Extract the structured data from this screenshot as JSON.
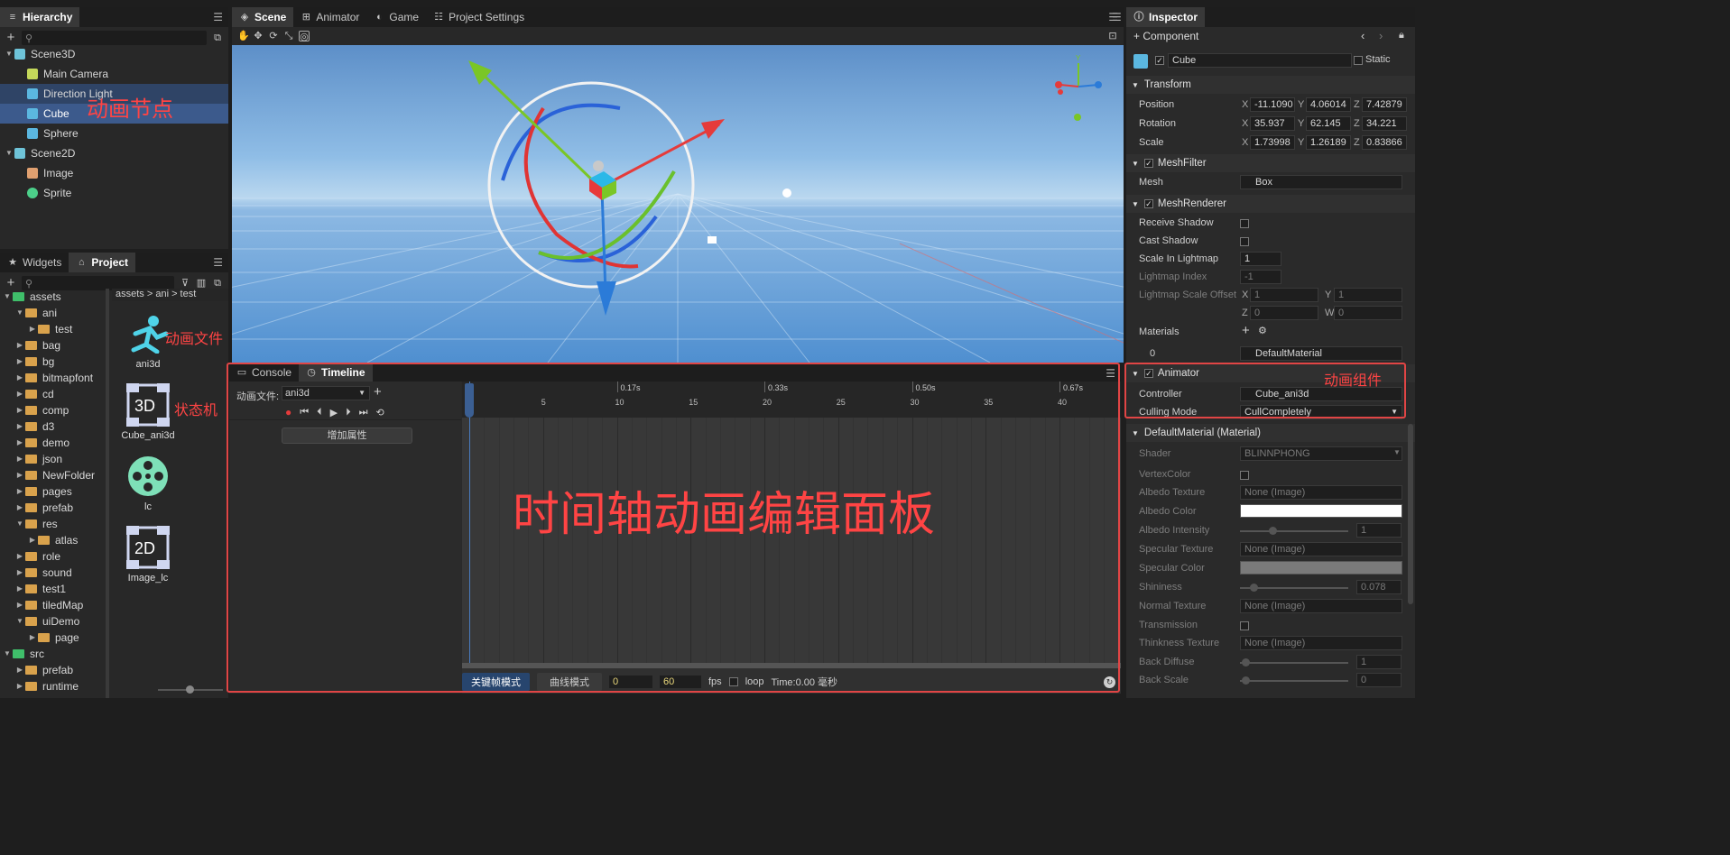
{
  "hierarchy": {
    "title": "Hierarchy",
    "items": [
      {
        "label": "Scene3D",
        "level": 0,
        "expanded": true,
        "icon": "scene-icon"
      },
      {
        "label": "Main Camera",
        "level": 1,
        "icon": "camera-icon"
      },
      {
        "label": "Direction Light",
        "level": 1,
        "icon": "cube-icon"
      },
      {
        "label": "Cube",
        "level": 1,
        "icon": "cube-icon",
        "selected": true
      },
      {
        "label": "Sphere",
        "level": 1,
        "icon": "cube-icon"
      },
      {
        "label": "Scene2D",
        "level": 0,
        "expanded": true,
        "icon": "scene-icon"
      },
      {
        "label": "Image",
        "level": 1,
        "icon": "image-icon"
      },
      {
        "label": "Sprite",
        "level": 1,
        "icon": "sprite-icon"
      }
    ]
  },
  "project": {
    "tabs": [
      "Widgets",
      "Project"
    ],
    "tree": [
      {
        "label": "assets",
        "level": 0,
        "expanded": true
      },
      {
        "label": "ani",
        "level": 1,
        "expanded": true
      },
      {
        "label": "test",
        "level": 2
      },
      {
        "label": "bag",
        "level": 1
      },
      {
        "label": "bg",
        "level": 1
      },
      {
        "label": "bitmapfont",
        "level": 1
      },
      {
        "label": "cd",
        "level": 1
      },
      {
        "label": "comp",
        "level": 1
      },
      {
        "label": "d3",
        "level": 1
      },
      {
        "label": "demo",
        "level": 1
      },
      {
        "label": "json",
        "level": 1
      },
      {
        "label": "NewFolder",
        "level": 1
      },
      {
        "label": "pages",
        "level": 1
      },
      {
        "label": "prefab",
        "level": 1
      },
      {
        "label": "res",
        "level": 1,
        "expanded": true
      },
      {
        "label": "atlas",
        "level": 2
      },
      {
        "label": "role",
        "level": 1
      },
      {
        "label": "sound",
        "level": 1
      },
      {
        "label": "test1",
        "level": 1
      },
      {
        "label": "tiledMap",
        "level": 1
      },
      {
        "label": "uiDemo",
        "level": 1,
        "expanded": true
      },
      {
        "label": "page",
        "level": 2
      },
      {
        "label": "src",
        "level": 0,
        "expanded": true
      },
      {
        "label": "prefab",
        "level": 1
      },
      {
        "label": "runtime",
        "level": 1
      }
    ],
    "breadcrumb": "assets > ani > test",
    "files": [
      {
        "label": "ani3d",
        "icon": "animation-file-icon"
      },
      {
        "label": "Cube_ani3d",
        "icon": "state-machine-3d-icon"
      },
      {
        "label": "lc",
        "icon": "film-reel-icon"
      },
      {
        "label": "Image_lc",
        "icon": "state-machine-2d-icon"
      }
    ]
  },
  "center_tabs": [
    "Scene",
    "Animator",
    "Game",
    "Project Settings"
  ],
  "bottom_tabs": [
    "Console",
    "Timeline"
  ],
  "timeline": {
    "file_label": "动画文件:",
    "file_value": "ani3d",
    "add_property": "增加属性",
    "time_marks": [
      "0.17s",
      "0.33s",
      "0.50s",
      "0.67s"
    ],
    "frames": [
      "0",
      "5",
      "10",
      "15",
      "20",
      "25",
      "30",
      "35",
      "40"
    ],
    "keyframe_mode": "关键帧模式",
    "curve_mode": "曲线模式",
    "start": "0",
    "fps_value": "60",
    "fps_label": "fps",
    "loop_label": "loop",
    "time_text": "Time:0.00 毫秒"
  },
  "inspector": {
    "title": "Inspector",
    "add_component": "Component",
    "name": "Cube",
    "static_label": "Static",
    "transform": {
      "title": "Transform",
      "position_label": "Position",
      "position": [
        "-11.1090",
        "4.06014",
        "7.42879"
      ],
      "rotation_label": "Rotation",
      "rotation": [
        "35.937",
        "62.145",
        "34.221"
      ],
      "scale_label": "Scale",
      "scale": [
        "1.73998",
        "1.26189",
        "0.83866"
      ]
    },
    "meshfilter": {
      "title": "MeshFilter",
      "mesh_label": "Mesh",
      "mesh_value": "Box"
    },
    "meshrenderer": {
      "title": "MeshRenderer",
      "receive_shadow": "Receive Shadow",
      "cast_shadow": "Cast Shadow",
      "scale_in_lightmap": "Scale In Lightmap",
      "scale_in_lightmap_value": "1",
      "lightmap_index": "Lightmap Index",
      "lightmap_index_value": "-1",
      "lightmap_scale_offset": "Lightmap Scale Offset",
      "offset_x": "1",
      "offset_y": "1",
      "offset_z": "0",
      "offset_w": "0",
      "materials": "Materials",
      "material_index": "0",
      "material_value": "DefaultMaterial"
    },
    "animator": {
      "title": "Animator",
      "controller_label": "Controller",
      "controller_value": "Cube_ani3d",
      "culling_label": "Culling Mode",
      "culling_value": "CullCompletely"
    },
    "material": {
      "title": "DefaultMaterial (Material)",
      "shader_label": "Shader",
      "shader_value": "BLINNPHONG",
      "vertex_color": "VertexColor",
      "albedo_texture": "Albedo Texture",
      "albedo_texture_value": "None (Image)",
      "albedo_color": "Albedo Color",
      "albedo_intensity": "Albedo Intensity",
      "albedo_intensity_value": "1",
      "specular_texture": "Specular Texture",
      "specular_texture_value": "None (Image)",
      "specular_color": "Specular Color",
      "shininess": "Shininess",
      "shininess_value": "0.078",
      "normal_texture": "Normal Texture",
      "normal_texture_value": "None (Image)",
      "transmission": "Transmission",
      "thinkness_texture": "Thinkness Texture",
      "thinkness_texture_value": "None (Image)",
      "back_diffuse": "Back Diffuse",
      "back_diffuse_value": "1",
      "back_scale": "Back Scale",
      "back_scale_value": "0"
    }
  },
  "annotations": {
    "node": "动画节点",
    "file": "动画文件",
    "state_machine": "状态机",
    "timeline": "时间轴动画编辑面板",
    "component": "动画组件"
  },
  "colors": {
    "accent": "#3c5a8c",
    "annotation": "#e14545",
    "scene_sky": "#7fb0dc"
  }
}
